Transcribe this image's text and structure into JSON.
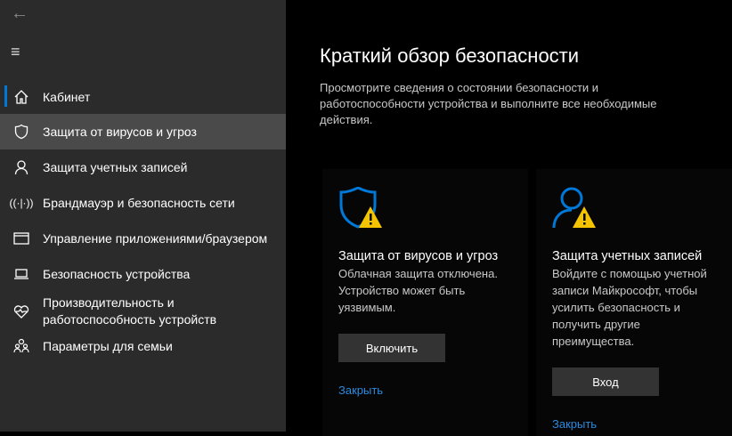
{
  "sidebar": {
    "items": [
      {
        "label": "Кабинет",
        "icon": "home-icon"
      },
      {
        "label": "Защита от вирусов и угроз",
        "icon": "shield-icon"
      },
      {
        "label": "Защита учетных записей",
        "icon": "person-icon"
      },
      {
        "label": "Брандмауэр и безопасность сети",
        "icon": "wifi-antenna-icon"
      },
      {
        "label": "Управление приложениями/браузером",
        "icon": "browser-window-icon"
      },
      {
        "label": "Безопасность устройства",
        "icon": "laptop-icon"
      },
      {
        "label": "Производительность и работоспособность устройств",
        "icon": "heart-icon"
      },
      {
        "label": "Параметры для семьи",
        "icon": "family-icon"
      }
    ]
  },
  "main": {
    "title": "Краткий обзор безопасности",
    "description": "Просмотрите сведения о состоянии безопасности и работоспособности устройства и выполните все необходимые действия.",
    "cards": [
      {
        "title": "Защита от вирусов и угроз",
        "text": "Облачная защита отключена. Устройство может быть уязвимым.",
        "button": "Включить",
        "link": "Закрыть"
      },
      {
        "title": "Защита учетных записей",
        "text": "Войдите с помощью учетной записи Майкрософт, чтобы усилить безопасность и получить другие преимущества.",
        "button": "Вход",
        "link": "Закрыть"
      }
    ]
  },
  "colors": {
    "accent": "#0078d7",
    "warning": "#f5c400"
  }
}
